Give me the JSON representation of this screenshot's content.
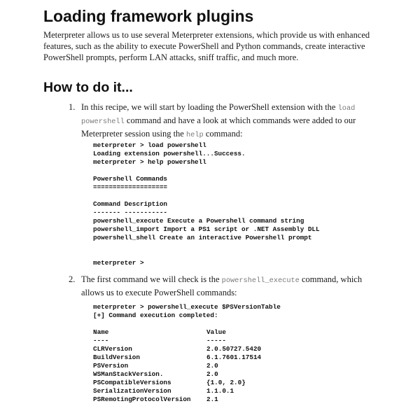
{
  "title": "Loading framework plugins",
  "intro": "Meterpreter allows us to use several Meterpreter extensions, which provide us with enhanced features, such as the ability to execute PowerShell and Python commands, create interactive PowerShell prompts, perform LAN attacks, sniff traffic, and much more.",
  "how_to_heading": "How to do it...",
  "step1": {
    "number": "1.",
    "text_a": "In this recipe, we will start by loading the PowerShell extension with the ",
    "code_a": "load powershell",
    "text_b": " command and have a look at which commands were added to our Meterpreter session using the ",
    "code_b": "help",
    "text_c": " command:",
    "code_lines": [
      "meterpreter > load powershell",
      "Loading extension powershell...Success.",
      "meterpreter > help powershell",
      "",
      "Powershell Commands",
      "===================",
      "",
      "Command Description",
      "------- -----------",
      "powershell_execute Execute a Powershell command string",
      "powershell_import Import a PS1 script or .NET Assembly DLL",
      "powershell_shell Create an interactive Powershell prompt",
      "",
      "",
      "meterpreter >"
    ]
  },
  "step2": {
    "number": "2.",
    "text_a": "The first command we will check is the ",
    "code_a": "powershell_execute",
    "text_b": " command, which allows us to execute PowerShell commands:",
    "code_lines": [
      "meterpreter > powershell_execute $PSVersionTable",
      "[+] Command execution completed:",
      ""
    ],
    "table_rows": [
      {
        "name": "Name",
        "value": "Value"
      },
      {
        "name": "----",
        "value": "-----"
      },
      {
        "name": "CLRVersion",
        "value": "2.0.50727.5420"
      },
      {
        "name": "BuildVersion",
        "value": "6.1.7601.17514"
      },
      {
        "name": "PSVersion",
        "value": "2.0"
      },
      {
        "name": "WSManStackVersion.",
        "value": "2.0"
      },
      {
        "name": "PSCompatibleVersions",
        "value": "{1.0, 2.0}"
      },
      {
        "name": "SerializationVersion",
        "value": "1.1.0.1"
      },
      {
        "name": "PSRemotingProtocolVersion",
        "value": "2.1"
      }
    ]
  }
}
